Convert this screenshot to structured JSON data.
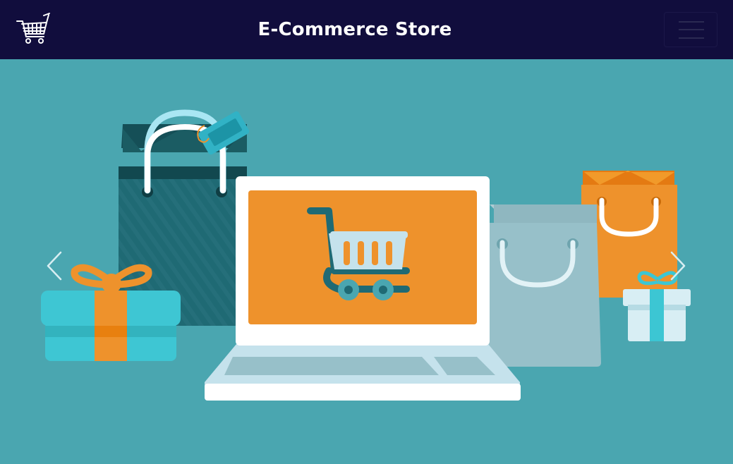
{
  "header": {
    "title": "E-Commerce Store",
    "logo_icon": "shopping-cart-icon",
    "menu_icon": "hamburger-menu-icon"
  },
  "carousel": {
    "prev_icon": "chevron-left-icon",
    "next_icon": "chevron-right-icon",
    "slide_illustration": "laptop-with-shopping-cart-and-shopping-bags"
  },
  "colors": {
    "navbar_bg": "#110d3d",
    "hero_bg": "#4aa6b0",
    "accent_orange": "#ee922c",
    "laptop_frame": "#ffffff",
    "light_blue": "#c5e2ec"
  }
}
